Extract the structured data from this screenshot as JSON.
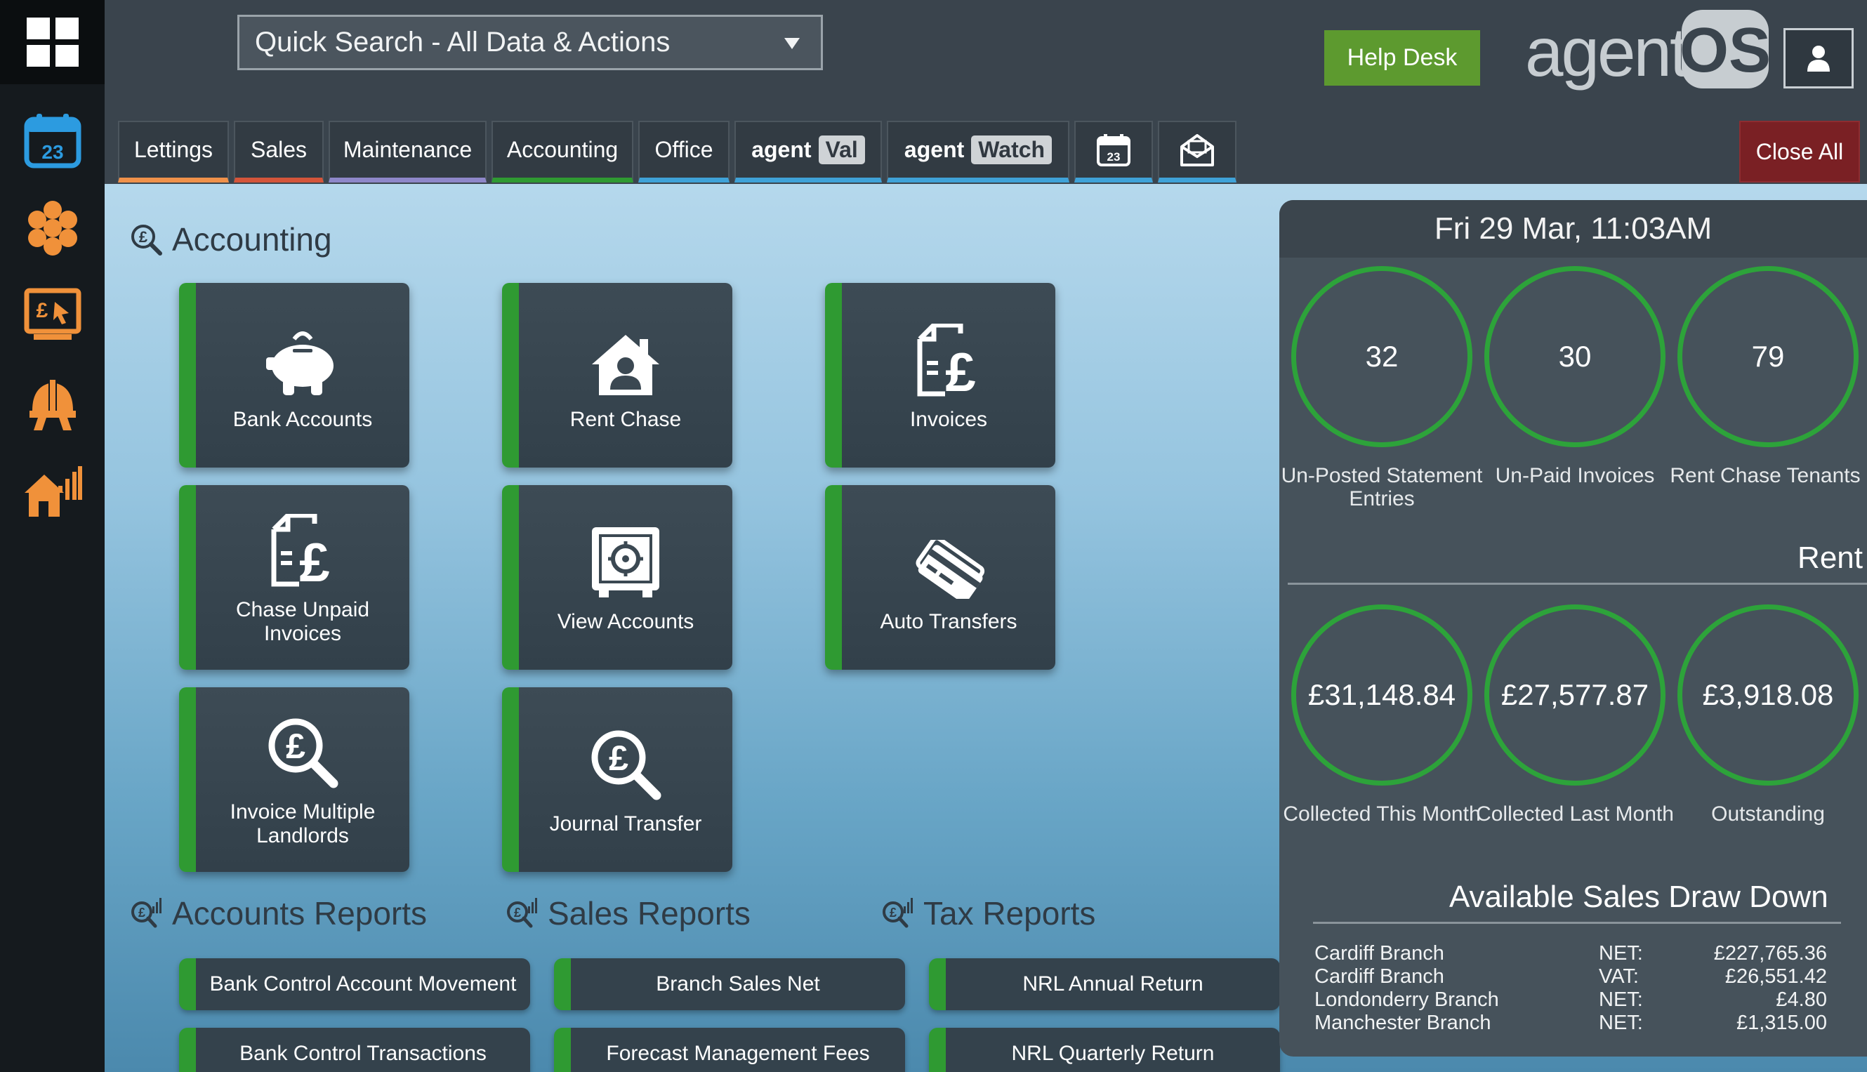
{
  "search": {
    "label": "Quick Search - All Data & Actions"
  },
  "header": {
    "help_desk": "Help Desk",
    "logo_text_a": "agent",
    "logo_text_b": "OS"
  },
  "rail": {
    "calendar_day": "23"
  },
  "tabs": [
    {
      "label": "Lettings",
      "color": "#f0914a"
    },
    {
      "label": "Sales",
      "color": "#d4553a"
    },
    {
      "label": "Maintenance",
      "color": "#8e87c9"
    },
    {
      "label": "Accounting",
      "color": "#2f9a32"
    },
    {
      "label": "Office",
      "color": "#3fa2d8"
    },
    {
      "label_a": "agent",
      "label_b": "Val",
      "color": "#3fa2d8"
    },
    {
      "label_a": "agent",
      "label_b": "Watch",
      "color": "#3fa2d8"
    }
  ],
  "tab_calendar_day": "23",
  "close_all": "Close All",
  "accounting": {
    "title": "Accounting",
    "tiles": [
      "Bank Accounts",
      "Rent Chase",
      "Invoices",
      "Chase Unpaid Invoices",
      "View Accounts",
      "Auto Transfers",
      "Invoice Multiple Landlords",
      "Journal Transfer"
    ]
  },
  "reports": {
    "accounts_title": "Accounts Reports",
    "sales_title": "Sales Reports",
    "tax_title": "Tax Reports",
    "accounts_items": [
      "Bank Control Account Movement",
      "Bank Control Transactions"
    ],
    "sales_items": [
      "Branch Sales Net",
      "Forecast Management Fees"
    ],
    "tax_items": [
      "NRL Annual Return",
      "NRL Quarterly Return"
    ]
  },
  "panel": {
    "datetime": "Fri 29 Mar, 11:03AM",
    "stats": [
      {
        "value": "32",
        "label": "Un-Posted Statement Entries"
      },
      {
        "value": "30",
        "label": "Un-Paid Invoices"
      },
      {
        "value": "79",
        "label": "Rent Chase Tenants"
      }
    ],
    "rent_title": "Rent",
    "rent": [
      {
        "value": "£31,148.84",
        "label": "Collected This Month"
      },
      {
        "value": "£27,577.87",
        "label": "Collected Last Month"
      },
      {
        "value": "£3,918.08",
        "label": "Outstanding"
      }
    ],
    "draw_title": "Available Sales Draw Down",
    "draw_rows": [
      {
        "branch": "Cardiff Branch",
        "type": "NET:",
        "value": "£227,765.36"
      },
      {
        "branch": "Cardiff Branch",
        "type": "VAT:",
        "value": "£26,551.42"
      },
      {
        "branch": "Londonderry Branch",
        "type": "NET:",
        "value": "£4.80"
      },
      {
        "branch": "Manchester Branch",
        "type": "NET:",
        "value": "£1,315.00"
      }
    ]
  },
  "colors": {
    "accent_green": "#2f9a32",
    "rail_orange": "#f0913a",
    "rail_blue": "#2c9be0",
    "close_red": "#7a2024",
    "help_green": "#5d9a2f"
  }
}
